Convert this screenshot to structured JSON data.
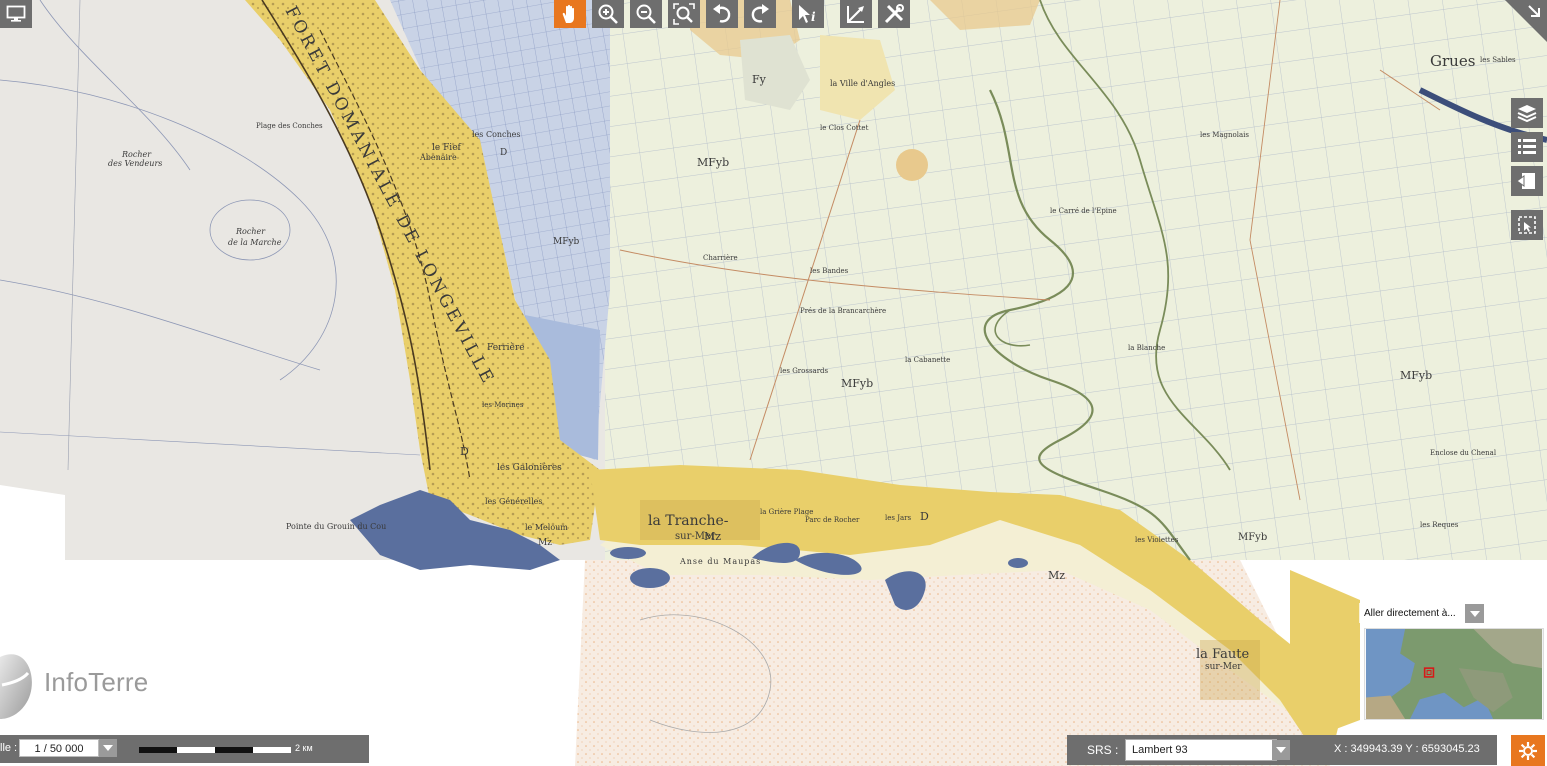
{
  "app": {
    "name": "InfoTerre"
  },
  "colors": {
    "accent": "#e8771f",
    "toolbar": "#6e6e6e",
    "sea": "#e9e7e3",
    "dune_yellow": "#e9cf6a",
    "marsh": "#ecf0dc",
    "rock_blue": "#5a6f9e",
    "sand_pale": "#f4efd4"
  },
  "toolbar": {
    "buttons": [
      {
        "name": "pan",
        "icon": "hand-icon",
        "active": true
      },
      {
        "name": "zoom-in",
        "icon": "zoom-in-icon"
      },
      {
        "name": "zoom-out",
        "icon": "zoom-out-icon"
      },
      {
        "name": "zoom-extent",
        "icon": "zoom-extent-icon"
      },
      {
        "name": "undo",
        "icon": "undo-icon"
      },
      {
        "name": "redo",
        "icon": "redo-icon"
      },
      {
        "name": "info",
        "icon": "info-pointer-icon"
      },
      {
        "name": "measure",
        "icon": "measure-icon"
      },
      {
        "name": "tools",
        "icon": "tools-icon"
      }
    ]
  },
  "side_panel": {
    "buttons": [
      {
        "name": "layers",
        "icon": "layers-icon"
      },
      {
        "name": "legend",
        "icon": "legend-list-icon"
      },
      {
        "name": "export",
        "icon": "export-icon"
      },
      {
        "name": "select-area",
        "icon": "select-area-icon"
      }
    ]
  },
  "map": {
    "labels": {
      "foret": "FORET DOMANIALE DE LONGEVILLE",
      "tranche": "la Tranche-",
      "tranche2": "sur-Mer",
      "faute": "la Faute",
      "faute2": "sur-Mer",
      "grues": "Grues",
      "rocher1": "Rocher",
      "rocher1b": "des Vendeurs",
      "rocher2": "Rocher",
      "rocher2b": "de la Marche",
      "plage_conches": "Plage des Conches",
      "les_conches": "les Conches",
      "fief": "le Fief",
      "abenaire": "Abenaire",
      "ferriere": "Ferrière",
      "galoinieres": "les Galonières",
      "generelles": "les Générelles",
      "meloum": "le Meloum",
      "pointe": "Pointe du Grouin du Cou",
      "anse": "Anse du Maupas",
      "mfy1": "MFyb",
      "mfy2": "MFyb",
      "mfy3": "MFyb",
      "mfy4": "MFyb",
      "mfy5": "MFyb",
      "mz1": "Mz",
      "mz2": "Mz",
      "mz3": "Mz",
      "d1": "D",
      "d2": "D",
      "d3": "D",
      "fy": "Fy",
      "ville": "la Ville d'Angles",
      "brancarchere": "Prés de la Brancarchère",
      "cabanette": "la Cabanette",
      "grossards": "les Grossards",
      "bandes": "les Bandes",
      "charriere": "Charrière",
      "clos": "le Clos Cottet",
      "morines": "les Morines",
      "magnolais": "les Magnolais",
      "sables": "les Sables",
      "grisla": "la Grière Plage",
      "parc": "Parc de Rocher",
      "jars": "les Jars",
      "viollettes": "les Violettes",
      "cruseau": "le Carré de l'Epine",
      "blanche": "la Blanche",
      "reques": "les Reques",
      "enclose": "Enclose du Chenal"
    }
  },
  "scale": {
    "label": "lle :",
    "value": "1 / 50 000",
    "distance": "2 км"
  },
  "goto": {
    "placeholder": "Aller directement à..."
  },
  "srs": {
    "label": "SRS :",
    "value": "Lambert 93",
    "coords": "X : 349943.39 Y : 6593045.23"
  }
}
